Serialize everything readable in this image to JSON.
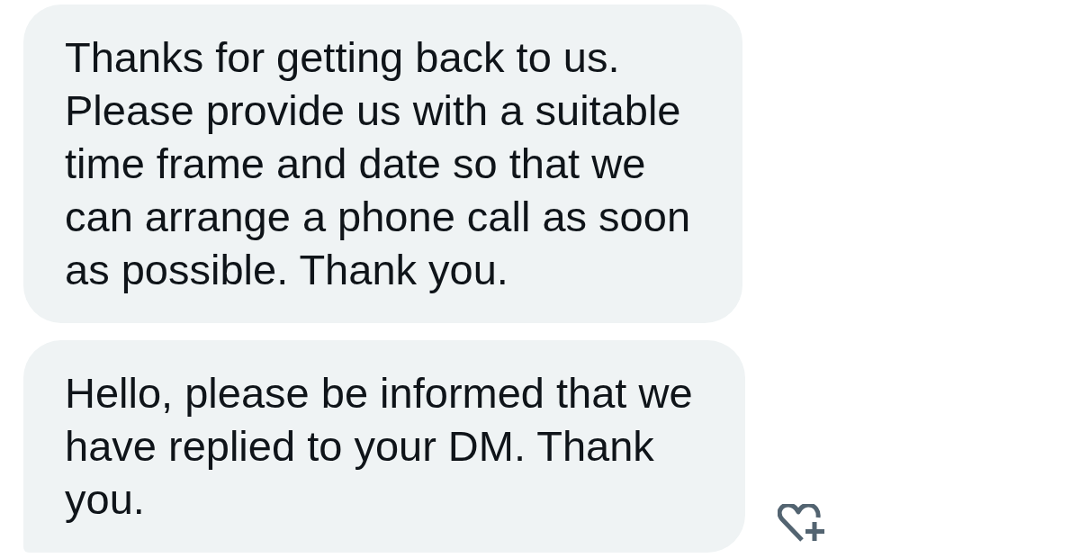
{
  "messages": [
    {
      "text": "Thanks for getting back to us.\nPlease provide us with a suitable\ntime frame and date so that we\ncan arrange a phone call as soon\nas possible. Thank you."
    },
    {
      "text": "Hello, please be informed that we\nhave replied to your DM. Thank\nyou."
    }
  ]
}
